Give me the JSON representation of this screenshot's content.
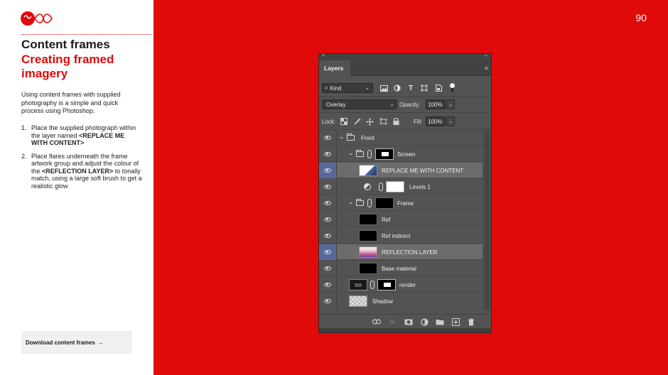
{
  "page": {
    "page_number": "90"
  },
  "sidebar": {
    "title_line1": "Content frames",
    "title_line2": "Creating framed imagery",
    "intro": "Using content frames with supplied photography is a simple and quick process using Photoshop.",
    "steps": [
      {
        "num": "1.",
        "text": "Place the supplied photograph within the layer named ",
        "bold": "<REPLACE ME WITH CONTENT>",
        "after": ""
      },
      {
        "num": "2.",
        "text": "Place flares underneath the frame artwork group and adjust the colour of the ",
        "bold": "<REFLECTION LAYER>",
        "after": " to tonally match, using a large soft brush to get a realistic glow"
      }
    ],
    "download_label": "Download content frames",
    "download_arrow": "→"
  },
  "photoshop": {
    "close_glyph": "×",
    "collapse_glyph": "‹‹",
    "tab_label": "Layers",
    "filter": {
      "kind_label": "Kind",
      "search_glyph": "⌕"
    },
    "blend_mode": "Overlay",
    "opacity_label": "Opacity:",
    "opacity_value": "100%",
    "lock_label": "Lock:",
    "fill_label": "Fill:",
    "fill_value": "100%",
    "layers": [
      {
        "name": "Front",
        "type": "group-open",
        "indent": 0,
        "selected": false
      },
      {
        "name": "Screen",
        "type": "group-open-mask",
        "indent": 1,
        "selected": false
      },
      {
        "name": "REPLACE ME WITH CONTENT",
        "type": "photo",
        "indent": 2,
        "selected": true
      },
      {
        "name": "Levels 1",
        "type": "adjustment",
        "indent": 2,
        "selected": false
      },
      {
        "name": "Frame",
        "type": "group-open-black",
        "indent": 1,
        "selected": false
      },
      {
        "name": "Ref",
        "type": "black",
        "indent": 2,
        "selected": false
      },
      {
        "name": "Ref indirect",
        "type": "black",
        "indent": 2,
        "selected": false
      },
      {
        "name": "REFLECTION LAYER",
        "type": "reflection",
        "indent": 2,
        "selected": true
      },
      {
        "name": "Base material",
        "type": "black",
        "indent": 2,
        "selected": false
      },
      {
        "name": "render",
        "type": "render-mask",
        "indent": 1,
        "selected": false
      },
      {
        "name": "Shadow",
        "type": "transparent",
        "indent": 1,
        "selected": false
      }
    ],
    "bottom_icons": [
      "link-icon",
      "fx-icon",
      "mask-icon",
      "adjustment-icon",
      "folder-icon",
      "new-layer-icon",
      "trash-icon"
    ],
    "fx_label": "fx"
  }
}
